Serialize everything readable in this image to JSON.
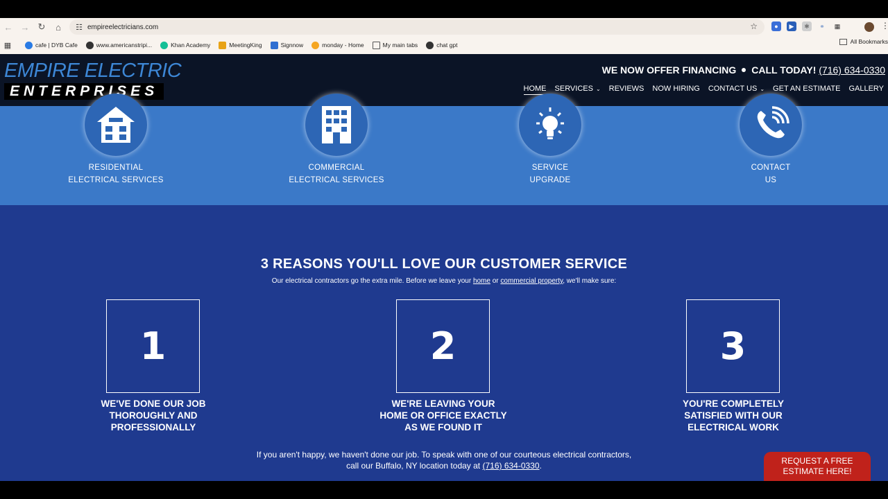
{
  "browser": {
    "url": "empireelectricians.com",
    "bookmarks": [
      {
        "label": "cafe | DYB Cafe",
        "color": "#2a7be4"
      },
      {
        "label": "www.americanstripi...",
        "color": "#333333"
      },
      {
        "label": "Khan Academy",
        "color": "#14bf96"
      },
      {
        "label": "MeetingKing",
        "color": "#e8a317"
      },
      {
        "label": "Signnow",
        "color": "#2f6fd1"
      },
      {
        "label": "monday - Home",
        "color": "#f5a623"
      },
      {
        "label": "My main tabs",
        "color": "#555555"
      },
      {
        "label": "chat gpt",
        "color": "#333333"
      }
    ],
    "all_bookmarks": "All Bookmarks"
  },
  "header": {
    "logo_line1": "EMPIRE ELECTRIC",
    "logo_line2": "ENTERPRISES",
    "financing": "WE NOW OFFER FINANCING",
    "call_label": "CALL TODAY!",
    "phone": "(716) 634-0330",
    "menu": {
      "home": "HOME",
      "services": "SERVICES",
      "reviews": "REVIEWS",
      "now_hiring": "NOW HIRING",
      "contact": "CONTACT US",
      "estimate": "GET AN ESTIMATE",
      "gallery": "GALLERY"
    }
  },
  "services": [
    {
      "line1": "RESIDENTIAL",
      "line2": "ELECTRICAL SERVICES",
      "icon": "house-icon"
    },
    {
      "line1": "COMMERCIAL",
      "line2": "ELECTRICAL SERVICES",
      "icon": "building-icon"
    },
    {
      "line1": "SERVICE",
      "line2": "UPGRADE",
      "icon": "lightbulb-icon"
    },
    {
      "line1": "CONTACT",
      "line2": "US",
      "icon": "phone-icon"
    }
  ],
  "reasons": {
    "title": "3 REASONS YOU'LL LOVE OUR CUSTOMER SERVICE",
    "sub_before": "Our electrical contractors go the extra mile. Before we leave your ",
    "sub_home": "home",
    "sub_or": " or ",
    "sub_commercial": "commercial property",
    "sub_after": ", we'll make sure:",
    "items": [
      {
        "number": "1",
        "l1": "WE'VE DONE OUR JOB",
        "l2": "THOROUGHLY AND",
        "l3": "PROFESSIONALLY"
      },
      {
        "number": "2",
        "l1": "WE'RE LEAVING YOUR",
        "l2": "HOME OR OFFICE EXACTLY",
        "l3": "AS WE FOUND IT"
      },
      {
        "number": "3",
        "l1": "YOU'RE COMPLETELY",
        "l2": "SATISFIED WITH OUR",
        "l3": "ELECTRICAL WORK"
      }
    ],
    "foot_line1": "If you aren't happy, we haven't done our job. To speak with one of our courteous electrical contractors,",
    "foot_line2_before": "call our Buffalo, NY location today at ",
    "foot_phone": "(716) 634-0330",
    "foot_period": ".",
    "cta_line1": "REQUEST A FREE",
    "cta_line2": "ESTIMATE HERE!"
  },
  "colors": {
    "header_bg": "#0b1426",
    "logo_blue": "#3d87d6",
    "services_bg": "#3b79c8",
    "reasons_bg": "#1f3a8f",
    "cta_red": "#c0221b"
  }
}
